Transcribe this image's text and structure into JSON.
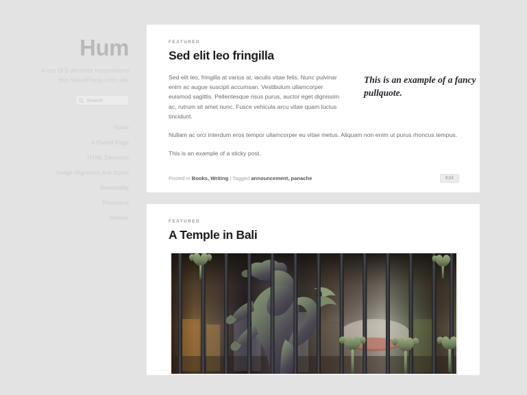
{
  "site": {
    "title": "Hum",
    "description": "4 out of 5 dentists recommend this WordPress.com site",
    "theme_background": "#e3e3e3",
    "card_background": "#ffffff",
    "title_color": "#b9b9b9"
  },
  "search": {
    "placeholder": "Search",
    "value": "",
    "icon": "search-icon"
  },
  "nav": {
    "items": [
      {
        "label": "Home"
      },
      {
        "label": "A Parent Page"
      },
      {
        "label": "HTML Elements"
      },
      {
        "label": "Image Alignment and Styles"
      },
      {
        "label": "Readability"
      },
      {
        "label": "Showcase"
      },
      {
        "label": "Sidebar"
      }
    ]
  },
  "posts": [
    {
      "featured_label": "FEATURED",
      "title": "Sed elit leo fringilla",
      "paragraph_1": "Sed elit leo, fringilla at varius at, iaculis vitae felis. Nunc pulvinar enim ac augue suscipit accumsan. Vestibulum ullamcorper euismod sagittis. Pellentesque risus purus, auctor eget dignissim ac, rutrum sit amet nunc. Fusce vehicula arcu vitae quam luctus tincidunt.",
      "pullquote": "This is an example of a fancy pullquote.",
      "paragraph_2": "Nullam ac orci interdum eros tempor ullamcorper eu vitae metus. Aliquam non enim ut purus rhoncus tempus.",
      "paragraph_3": "This is an example of a sticky post.",
      "meta": {
        "posted_in_prefix": "Posted in ",
        "categories": "Books, Writing",
        "separator": " | ",
        "tagged_prefix": "Tagged ",
        "tags": "announcement, panache"
      },
      "edit_label": "Edit"
    },
    {
      "featured_label": "FEATURED",
      "title": "A Temple in Bali",
      "photo_alt": "Bronze lion statue behind an ornate wrought iron gate"
    }
  ]
}
